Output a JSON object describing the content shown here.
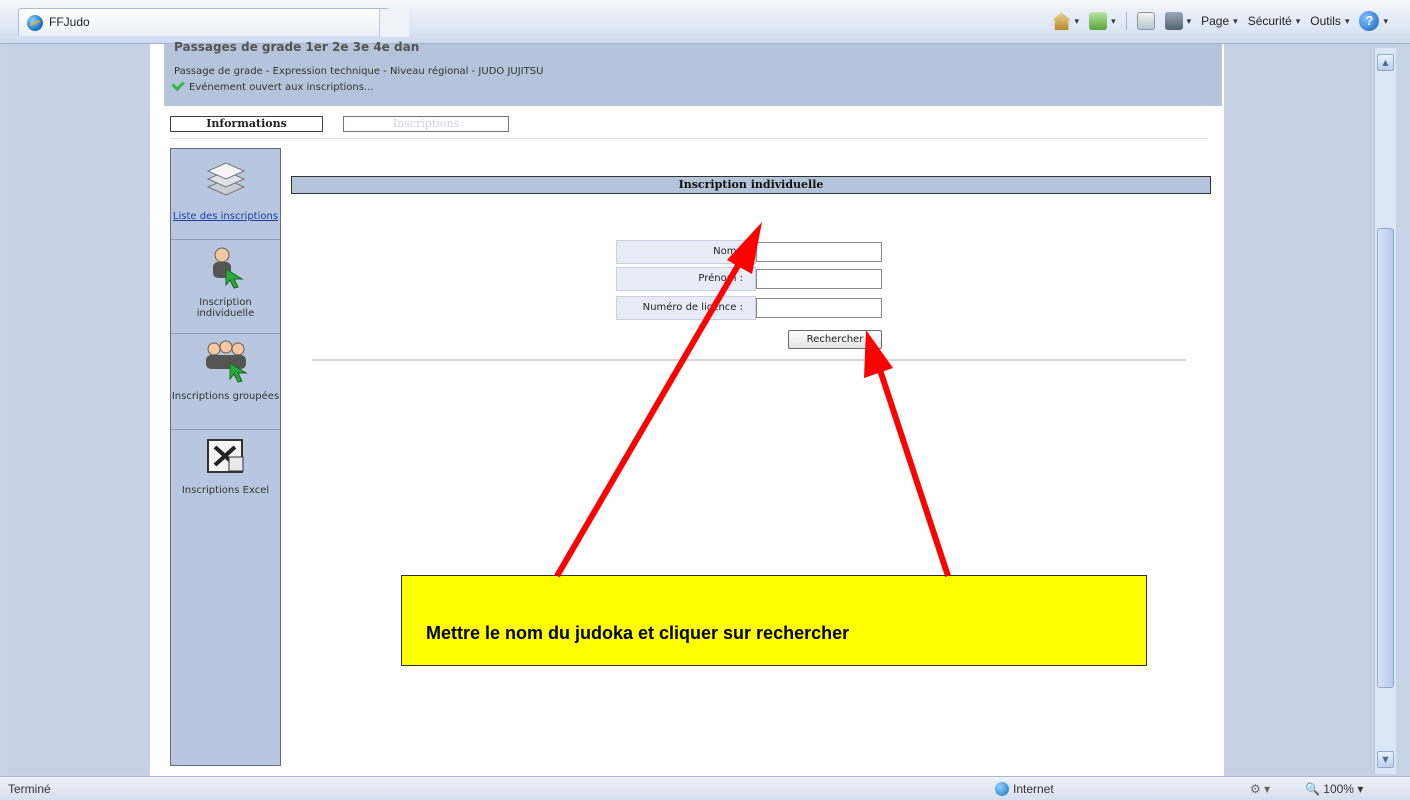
{
  "browser": {
    "tab_title": "FFJudo",
    "command_bar": {
      "page_label": "Page",
      "security_label": "Sécurité",
      "tools_label": "Outils"
    },
    "status": {
      "left_text": "Terminé",
      "zone_text": "Internet",
      "zoom": "100%"
    }
  },
  "page": {
    "header": {
      "title_partial": "Passages de grade 1er 2e 3e 4e dan",
      "subtitle": "Passage de grade - Expression technique - Niveau régional - JUDO JUJITSU",
      "status": "Evénement ouvert aux inscriptions..."
    },
    "tabs": [
      {
        "label": "Informations"
      },
      {
        "label": "Inscriptions"
      }
    ],
    "sidenav": [
      {
        "label": "Liste des inscriptions",
        "icon": "document-stack-icon"
      },
      {
        "label": "Inscription individuelle",
        "icon": "person-add-icon"
      },
      {
        "label": "Inscriptions groupées",
        "icon": "group-add-icon"
      },
      {
        "label": "Inscriptions Excel",
        "icon": "excel-icon"
      }
    ],
    "section_title": "Inscription individuelle",
    "form": {
      "nom_label": "Nom :",
      "prenom_label": "Prénom :",
      "licence_label": "Numéro de licence :",
      "nom_value": "",
      "prenom_value": "",
      "licence_value": "",
      "search_button": "Rechercher"
    }
  },
  "annotation": {
    "text": "Mettre le nom du judoka et cliquer sur rechercher",
    "box_color": "#ffff00",
    "arrow_color": "#ff0000"
  }
}
